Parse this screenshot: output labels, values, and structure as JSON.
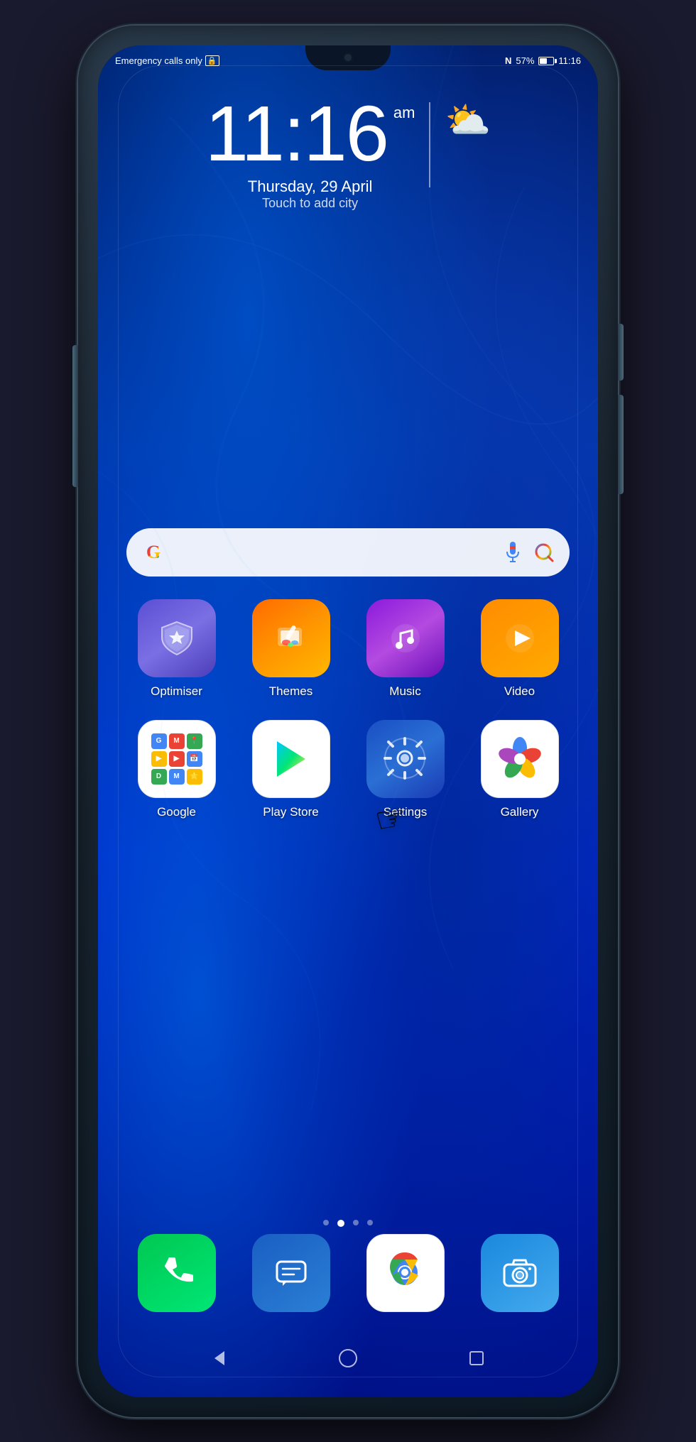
{
  "status": {
    "left_text": "Emergency calls only",
    "nfc": "N",
    "battery_percent": "57%",
    "time": "11:16"
  },
  "clock": {
    "time": "11:16",
    "am_pm": "am",
    "date": "Thursday, 29 April",
    "city": "Touch to add city"
  },
  "search": {
    "placeholder": ""
  },
  "apps": {
    "row1": [
      {
        "name": "Optimiser",
        "id": "optimiser"
      },
      {
        "name": "Themes",
        "id": "themes"
      },
      {
        "name": "Music",
        "id": "music"
      },
      {
        "name": "Video",
        "id": "video"
      }
    ],
    "row2": [
      {
        "name": "Google",
        "id": "google"
      },
      {
        "name": "Play Store",
        "id": "playstore"
      },
      {
        "name": "Settings",
        "id": "settings"
      },
      {
        "name": "Gallery",
        "id": "gallery"
      }
    ]
  },
  "dock": [
    {
      "name": "Phone",
      "id": "phone"
    },
    {
      "name": "Messages",
      "id": "messages"
    },
    {
      "name": "Chrome",
      "id": "chrome"
    },
    {
      "name": "Camera",
      "id": "camera"
    }
  ],
  "nav": {
    "back": "◁",
    "home": "○",
    "recents": "□"
  },
  "page_dots": [
    0,
    1,
    2,
    3
  ],
  "active_dot": 1
}
